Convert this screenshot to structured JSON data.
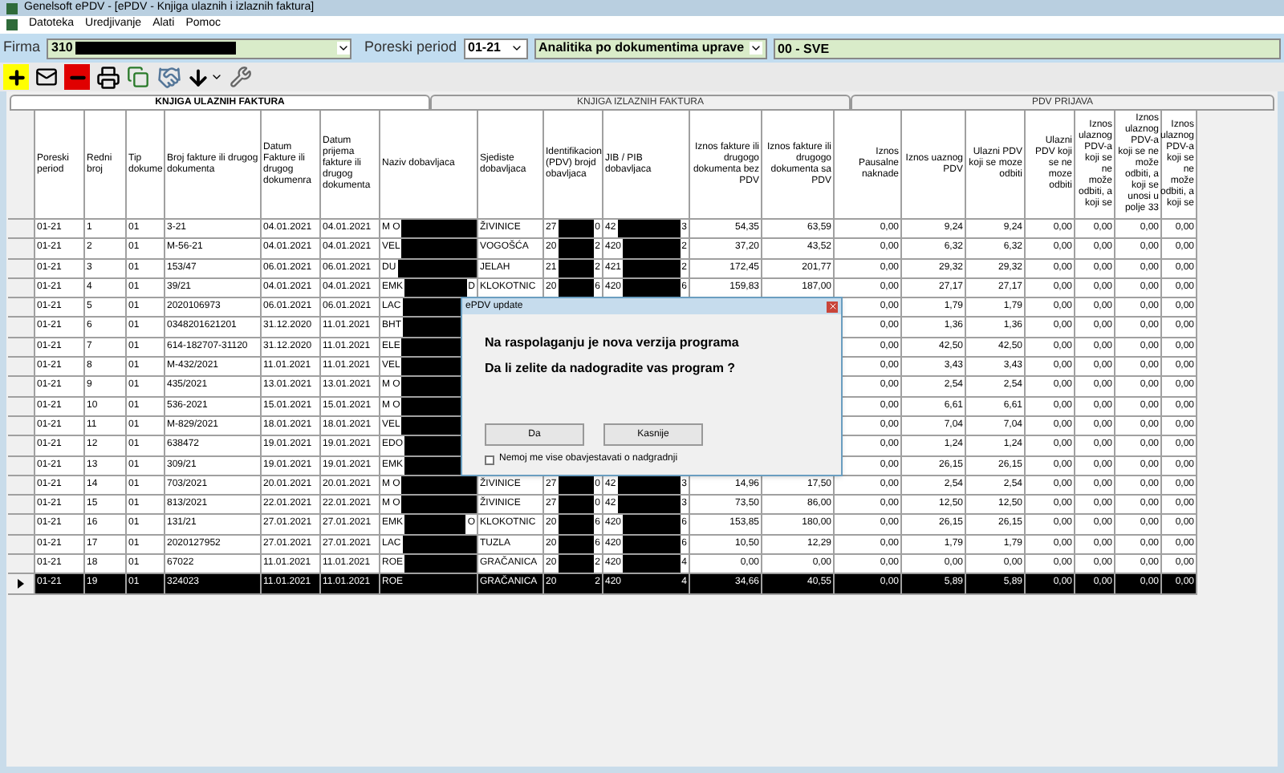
{
  "window": {
    "title": "Genelsoft ePDV - [ePDV - Knjiga ulaznih i izlaznih faktura]"
  },
  "menu": [
    "Datoteka",
    "Uredjivanje",
    "Alati",
    "Pomoc"
  ],
  "filter": {
    "firma_label": "Firma",
    "firma_value": "310",
    "period_label": "Poreski period",
    "period_value": "01-21",
    "report": "Analitika po dokumentima uprave",
    "scope": "00 - SVE"
  },
  "tabs": [
    {
      "label": "KNJIGA ULAZNIH FAKTURA",
      "selected": true
    },
    {
      "label": "KNJIGA IZLAZNIH FAKTURA",
      "selected": false
    },
    {
      "label": "PDV PRIJAVA",
      "selected": false
    }
  ],
  "table": {
    "columns": [
      "Poreski period",
      "Redni broj",
      "Tip dokume",
      "Broj fakture ili drugog dokumenta",
      "Datum Fakture ili drugog dokumenra",
      "Datum prijema fakture ili drugog dokumenta",
      "Naziv dobavljaca",
      "Sjediste dobavljaca",
      "Identifikacion (PDV) brojd obavljaca",
      "JIB / PIB dobavljaca",
      "Iznos fakture ili drugogo dokumenta bez PDV",
      "Iznos fakture ili drugogo dokumenta sa PDV",
      "Iznos Pausalne naknade",
      "Iznos uaznog PDV",
      "Ulazni PDV koji se moze odbiti",
      "Ulazni PDV koji se ne moze odbiti",
      "Iznos ulaznog PDV-a koji se ne može odbiti, a koji se",
      "Iznos ulaznog PDV-a koji se ne može odbiti, a koji se unosi u polje 33",
      "Iznos ulaznog PDV-a koji se ne može odbiti, a koji se"
    ],
    "rows": [
      {
        "selected": false,
        "lead": [
          "01-21",
          "1",
          "01",
          "3-21",
          "04.01.2021",
          "04.01.2021"
        ],
        "supplier": {
          "before": "M O"
        },
        "mid": [
          "ŽIVINICE",
          {
            "before": "27",
            "after": "0"
          },
          {
            "before": "42",
            "after": "3"
          },
          "54,35",
          "63,59"
        ],
        "tail": [
          "0,00",
          "9,24",
          "9,24",
          "0,00",
          "0,00",
          "0,00",
          "0,00"
        ]
      },
      {
        "selected": false,
        "lead": [
          "01-21",
          "2",
          "01",
          "M-56-21",
          "04.01.2021",
          "04.01.2021"
        ],
        "supplier": {
          "before": "VEL"
        },
        "mid": [
          "VOGOŠĆA",
          {
            "before": "20",
            "after": "2"
          },
          {
            "before": "420",
            "after": "2"
          },
          "37,20",
          "43,52"
        ],
        "tail": [
          "0,00",
          "6,32",
          "6,32",
          "0,00",
          "0,00",
          "0,00",
          "0,00"
        ]
      },
      {
        "selected": false,
        "lead": [
          "01-21",
          "3",
          "01",
          "153/47",
          "06.01.2021",
          "06.01.2021"
        ],
        "supplier": {
          "before": "DU"
        },
        "mid": [
          "JELAH",
          {
            "before": "21",
            "after": "2"
          },
          {
            "before": "421",
            "after": "2"
          },
          "172,45",
          "201,77"
        ],
        "tail": [
          "0,00",
          "29,32",
          "29,32",
          "0,00",
          "0,00",
          "0,00",
          "0,00"
        ]
      },
      {
        "selected": false,
        "lead": [
          "01-21",
          "4",
          "01",
          "39/21",
          "04.01.2021",
          "04.01.2021"
        ],
        "supplier": {
          "before": "EMK",
          "after": "D"
        },
        "mid": [
          "KLOKOTNIC",
          {
            "before": "20",
            "after": "6"
          },
          {
            "before": "420",
            "after": "6"
          },
          "159,83",
          "187,00"
        ],
        "tail": [
          "0,00",
          "27,17",
          "27,17",
          "0,00",
          "0,00",
          "0,00",
          "0,00"
        ]
      },
      {
        "selected": false,
        "lead": [
          "01-21",
          "5",
          "01",
          "2020106973",
          "06.01.2021",
          "06.01.2021"
        ],
        "supplier": {
          "before": "LAC"
        },
        "tail": [
          "0,00",
          "1,79",
          "1,79",
          "0,00",
          "0,00",
          "0,00",
          "0,00"
        ]
      },
      {
        "selected": false,
        "lead": [
          "01-21",
          "6",
          "01",
          "0348201621201",
          "31.12.2020",
          "11.01.2021"
        ],
        "supplier": {
          "before": "BHT"
        },
        "tail": [
          "0,00",
          "1,36",
          "1,36",
          "0,00",
          "0,00",
          "0,00",
          "0,00"
        ]
      },
      {
        "selected": false,
        "lead": [
          "01-21",
          "7",
          "01",
          "614-182707-31120",
          "31.12.2020",
          "11.01.2021"
        ],
        "supplier": {
          "before": "ELE"
        },
        "tail": [
          "0,00",
          "42,50",
          "42,50",
          "0,00",
          "0,00",
          "0,00",
          "0,00"
        ]
      },
      {
        "selected": false,
        "lead": [
          "01-21",
          "8",
          "01",
          "M-432/2021",
          "11.01.2021",
          "11.01.2021"
        ],
        "supplier": {
          "before": "VEL"
        },
        "tail": [
          "0,00",
          "3,43",
          "3,43",
          "0,00",
          "0,00",
          "0,00",
          "0,00"
        ]
      },
      {
        "selected": false,
        "lead": [
          "01-21",
          "9",
          "01",
          "435/2021",
          "13.01.2021",
          "13.01.2021"
        ],
        "supplier": {
          "before": "M O"
        },
        "tail": [
          "0,00",
          "2,54",
          "2,54",
          "0,00",
          "0,00",
          "0,00",
          "0,00"
        ]
      },
      {
        "selected": false,
        "lead": [
          "01-21",
          "10",
          "01",
          "536-2021",
          "15.01.2021",
          "15.01.2021"
        ],
        "supplier": {
          "before": "M O"
        },
        "tail": [
          "0,00",
          "6,61",
          "6,61",
          "0,00",
          "0,00",
          "0,00",
          "0,00"
        ]
      },
      {
        "selected": false,
        "lead": [
          "01-21",
          "11",
          "01",
          "M-829/2021",
          "18.01.2021",
          "18.01.2021"
        ],
        "supplier": {
          "before": "VEL"
        },
        "tail": [
          "0,00",
          "7,04",
          "7,04",
          "0,00",
          "0,00",
          "0,00",
          "0,00"
        ]
      },
      {
        "selected": false,
        "lead": [
          "01-21",
          "12",
          "01",
          "638472",
          "19.01.2021",
          "19.01.2021"
        ],
        "supplier": {
          "before": "EDO"
        },
        "tail": [
          "0,00",
          "1,24",
          "1,24",
          "0,00",
          "0,00",
          "0,00",
          "0,00"
        ]
      },
      {
        "selected": false,
        "lead": [
          "01-21",
          "13",
          "01",
          "309/21",
          "19.01.2021",
          "19.01.2021"
        ],
        "supplier": {
          "before": "EMK"
        },
        "tail": [
          "0,00",
          "26,15",
          "26,15",
          "0,00",
          "0,00",
          "0,00",
          "0,00"
        ]
      },
      {
        "selected": false,
        "lead": [
          "01-21",
          "14",
          "01",
          "703/2021",
          "20.01.2021",
          "20.01.2021"
        ],
        "supplier": {
          "before": "M O"
        },
        "mid": [
          "ŽIVINICE",
          {
            "before": "27",
            "after": "0"
          },
          {
            "before": "42",
            "after": "3"
          },
          "14,96",
          "17,50"
        ],
        "tail": [
          "0,00",
          "2,54",
          "2,54",
          "0,00",
          "0,00",
          "0,00",
          "0,00"
        ]
      },
      {
        "selected": false,
        "lead": [
          "01-21",
          "15",
          "01",
          "813/2021",
          "22.01.2021",
          "22.01.2021"
        ],
        "supplier": {
          "before": "M O"
        },
        "mid": [
          "ŽIVINICE",
          {
            "before": "27",
            "after": "0"
          },
          {
            "before": "42",
            "after": "3"
          },
          "73,50",
          "86,00"
        ],
        "tail": [
          "0,00",
          "12,50",
          "12,50",
          "0,00",
          "0,00",
          "0,00",
          "0,00"
        ]
      },
      {
        "selected": false,
        "lead": [
          "01-21",
          "16",
          "01",
          "131/21",
          "27.01.2021",
          "27.01.2021"
        ],
        "supplier": {
          "before": "EMK",
          "after": "O"
        },
        "mid": [
          "KLOKOTNIC",
          {
            "before": "20",
            "after": "6"
          },
          {
            "before": "420",
            "after": "6"
          },
          "153,85",
          "180,00"
        ],
        "tail": [
          "0,00",
          "26,15",
          "26,15",
          "0,00",
          "0,00",
          "0,00",
          "0,00"
        ]
      },
      {
        "selected": false,
        "lead": [
          "01-21",
          "17",
          "01",
          "2020127952",
          "27.01.2021",
          "27.01.2021"
        ],
        "supplier": {
          "before": "LAC"
        },
        "mid": [
          "TUZLA",
          {
            "before": "20",
            "after": "6"
          },
          {
            "before": "420",
            "after": "6"
          },
          "10,50",
          "12,29"
        ],
        "tail": [
          "0,00",
          "1,79",
          "1,79",
          "0,00",
          "0,00",
          "0,00",
          "0,00"
        ]
      },
      {
        "selected": false,
        "lead": [
          "01-21",
          "18",
          "01",
          "67022",
          "11.01.2021",
          "11.01.2021"
        ],
        "supplier": {
          "before": "ROE"
        },
        "mid": [
          "GRAČANICA",
          {
            "before": "20",
            "after": "2"
          },
          {
            "before": "420",
            "after": "4"
          },
          "0,00",
          "0,00"
        ],
        "tail": [
          "0,00",
          "0,00",
          "0,00",
          "0,00",
          "0,00",
          "0,00",
          "0,00"
        ]
      },
      {
        "selected": true,
        "lead": [
          "01-21",
          "19",
          "01",
          "324023",
          "11.01.2021",
          "11.01.2021"
        ],
        "supplier": {
          "before": "ROE"
        },
        "mid": [
          "GRAČANICA",
          {
            "before": "20",
            "after": "2"
          },
          {
            "before": "420",
            "after": "4"
          },
          "34,66",
          "40,55"
        ],
        "tail": [
          "0,00",
          "5,89",
          "5,89",
          "0,00",
          "0,00",
          "0,00",
          "0,00"
        ]
      }
    ]
  },
  "dialog": {
    "title": "ePDV update",
    "lines": [
      "Na raspolaganju je nova verzija programa",
      "Da li zelite da nadogradite vas program ?"
    ],
    "buttons": [
      "Da",
      "Kasnije"
    ],
    "checkbox": {
      "label": "Nemoj me vise obavjestavati o nadgradnji",
      "checked": false
    }
  }
}
